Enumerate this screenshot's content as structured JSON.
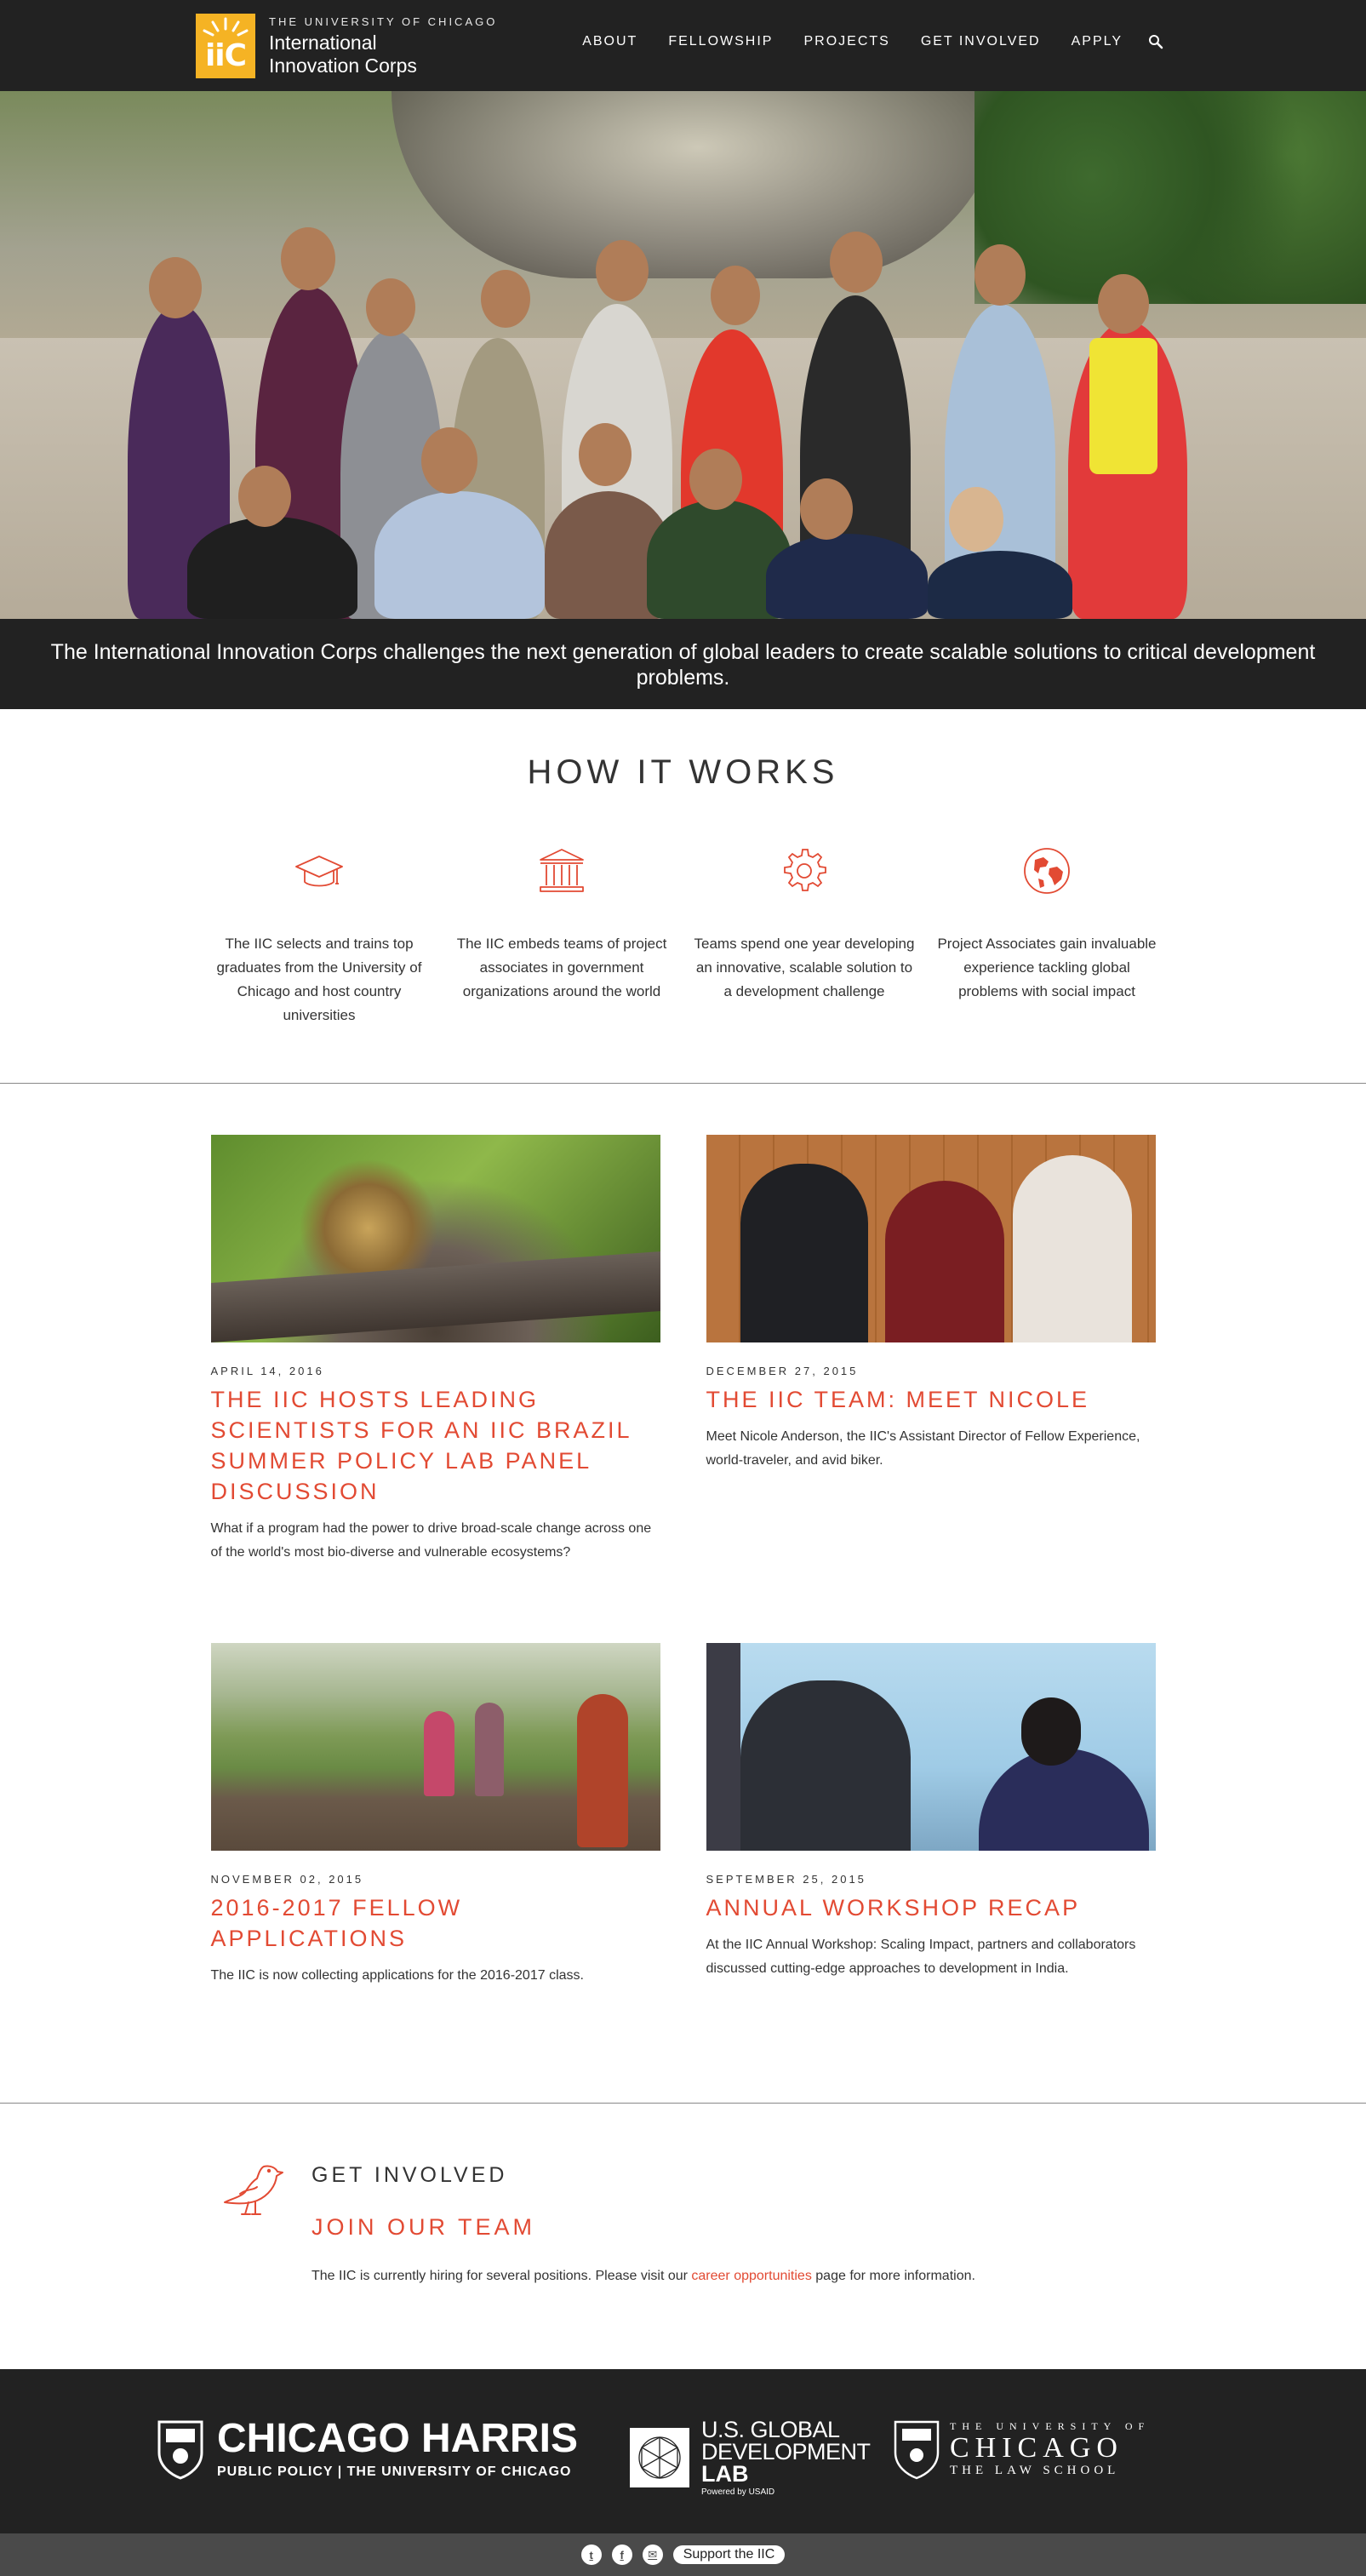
{
  "header": {
    "logo_small": "THE UNIVERSITY OF CHICAGO",
    "logo_line1": "International",
    "logo_line2": "Innovation Corps",
    "logo_mark": "iiC",
    "nav": [
      {
        "label": "ABOUT"
      },
      {
        "label": "FELLOWSHIP"
      },
      {
        "label": "PROJECTS"
      },
      {
        "label": "GET INVOLVED"
      },
      {
        "label": "APPLY"
      }
    ],
    "search_icon": "search-icon"
  },
  "tagline": "The International Innovation Corps challenges the next generation of global leaders to create scalable solutions to critical development problems.",
  "how": {
    "title": "HOW IT WORKS",
    "accent": "#e24a33",
    "steps": [
      {
        "icon": "graduation-cap-icon",
        "text": "The IIC selects and trains top graduates from the University of Chicago and host country universities"
      },
      {
        "icon": "government-building-icon",
        "text": "The IIC embeds teams of project associates in government organizations around the world"
      },
      {
        "icon": "gear-icon",
        "text": "Teams spend one year developing an innovative, scalable solution to a development challenge"
      },
      {
        "icon": "globe-icon",
        "text": "Project Associates gain invaluable experience tackling global problems with social impact"
      }
    ]
  },
  "posts": [
    {
      "date": "APRIL 14, 2016",
      "title": "THE IIC HOSTS LEADING SCIENTISTS FOR AN IIC BRAZIL SUMMER POLICY LAB PANEL DISCUSSION",
      "excerpt": "What if a program had the power to drive broad-scale change across one of the world's most bio-diverse and vulnerable ecosystems?"
    },
    {
      "date": "DECEMBER 27, 2015",
      "title": "THE IIC TEAM: MEET NICOLE",
      "excerpt": "Meet Nicole Anderson, the IIC's Assistant Director of Fellow Experience, world-traveler, and avid biker."
    },
    {
      "date": "NOVEMBER 02, 2015",
      "title": "2016-2017 FELLOW APPLICATIONS",
      "excerpt": "The IIC is now collecting applications for the 2016-2017 class."
    },
    {
      "date": "SEPTEMBER 25, 2015",
      "title": "ANNUAL WORKSHOP RECAP",
      "excerpt": "At the IIC Annual Workshop: Scaling Impact, partners and collaborators discussed cutting-edge approaches to development in India."
    }
  ],
  "involved": {
    "kicker": "GET INVOLVED",
    "title": "JOIN OUR TEAM",
    "text_before": "The IIC is currently hiring for several positions. Please visit our",
    "link": "career opportunities",
    "text_after": "page for more information."
  },
  "footer": {
    "harris_line1": "CHICAGO HARRIS",
    "harris_line2": "PUBLIC POLICY | THE UNIVERSITY OF CHICAGO",
    "usaid_line1": "U.S. GLOBAL",
    "usaid_line2": "DEVELOPMENT",
    "usaid_line3": "LAB",
    "usaid_powered": "Powered by USAID",
    "law_line1": "THE UNIVERSITY OF",
    "law_line2": "CHICAGO",
    "law_line3": "THE LAW SCHOOL",
    "social": [
      {
        "icon": "twitter-icon",
        "glyph": "t"
      },
      {
        "icon": "facebook-icon",
        "glyph": "f"
      },
      {
        "icon": "email-icon",
        "glyph": "✉"
      }
    ],
    "support": "Support the IIC"
  }
}
